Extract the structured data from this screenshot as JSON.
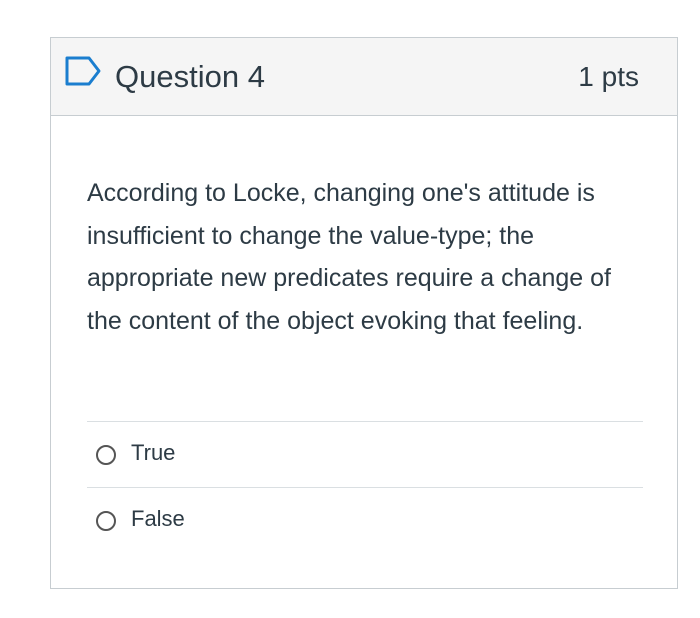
{
  "question": {
    "title": "Question 4",
    "points": "1 pts",
    "flag_icon": "bookmark-flag-icon",
    "text": "According to Locke, changing one's attitude is insufficient to change the value-type; the appropriate new predicates require a change of the content of the object evoking that feeling."
  },
  "answers": [
    {
      "label": "True",
      "selected": false
    },
    {
      "label": "False",
      "selected": false
    }
  ],
  "colors": {
    "header_bg": "#f5f5f5",
    "border": "#c7cdd1",
    "text": "#2d3b45",
    "flag": "#1b7ecf"
  }
}
